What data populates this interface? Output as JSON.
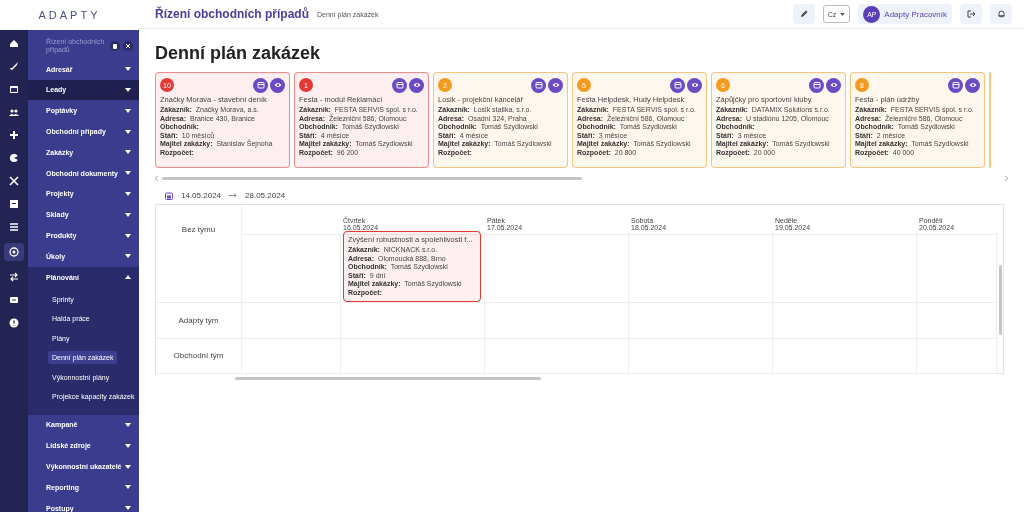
{
  "logo": "ADAPTY",
  "sidebar": {
    "title": "Řízení obchodních případů",
    "items": [
      {
        "label": "Adresář",
        "expanded": false,
        "selected": false
      },
      {
        "label": "Leady",
        "expanded": false,
        "selected": true
      },
      {
        "label": "Poptávky",
        "expanded": false,
        "selected": false
      },
      {
        "label": "Obchodní případy",
        "expanded": false,
        "selected": false
      },
      {
        "label": "Zakázky",
        "expanded": false,
        "selected": false
      },
      {
        "label": "Obchodní dokumenty",
        "expanded": false,
        "selected": false
      },
      {
        "label": "Projekty",
        "expanded": false,
        "selected": false
      },
      {
        "label": "Sklady",
        "expanded": false,
        "selected": false
      },
      {
        "label": "Produkty",
        "expanded": false,
        "selected": false
      },
      {
        "label": "Úkoly",
        "expanded": false,
        "selected": false
      },
      {
        "label": "Plánování",
        "expanded": true,
        "selected": false,
        "children": [
          {
            "label": "Sprinty",
            "selected": false
          },
          {
            "label": "Halda práce",
            "selected": false
          },
          {
            "label": "Plány",
            "selected": false
          },
          {
            "label": "Denní plán zakázek",
            "selected": true
          },
          {
            "label": "Výkonnostní plány",
            "selected": false
          },
          {
            "label": "Projekce kapacity zakázek",
            "selected": false
          }
        ]
      },
      {
        "label": "Kampaně",
        "expanded": false,
        "selected": false
      },
      {
        "label": "Lidské zdroje",
        "expanded": false,
        "selected": false
      },
      {
        "label": "Výkonnostní ukazatelé",
        "expanded": false,
        "selected": false
      },
      {
        "label": "Reporting",
        "expanded": false,
        "selected": false
      },
      {
        "label": "Postupy",
        "expanded": false,
        "selected": false
      }
    ]
  },
  "header": {
    "title": "Řízení obchodních případů",
    "breadcrumb": "Denní plán zakázek",
    "language": "Cz",
    "user_initials": "AP",
    "user_name": "Adapty Pracovník"
  },
  "page_title": "Denní plán zakázek",
  "cards": [
    {
      "badge": "10",
      "color": "#e53935",
      "title": "Značky Morava - stavební deník",
      "fields": [
        {
          "label": "Zákazník:",
          "value": "Značky Morava, a.s."
        },
        {
          "label": "Adresa:",
          "value": "Branice 430, Branice"
        },
        {
          "label": "Obchodník:"
        },
        {
          "label": "Stáří:",
          "value": "10 měsíců"
        },
        {
          "label": "Majitel zakázky:",
          "value": "Stanislav Šejnoha"
        },
        {
          "label": "Rozpočet:"
        }
      ]
    },
    {
      "badge": "1",
      "color": "#e53935",
      "title": "Festa - modul Reklamací",
      "fields": [
        {
          "label": "Zákazník:",
          "value": "FESTA SERVIS spol. s r.o."
        },
        {
          "label": "Adresa:",
          "value": "Železniční 586, Olomouc"
        },
        {
          "label": "Obchodník:",
          "value": "Tomáš Szydlowski"
        },
        {
          "label": "Stáří:",
          "value": "4 měsíce"
        },
        {
          "label": "Majitel zakázky:",
          "value": "Tomáš Szydlowski"
        },
        {
          "label": "Rozpočet:",
          "value": "96 200"
        }
      ]
    },
    {
      "badge": "2",
      "color": "#f39a1f",
      "title": "Losik - projekční kancelář",
      "fields": [
        {
          "label": "Zákazník:",
          "value": "Losik statika, s.r.o."
        },
        {
          "label": "Adresa:",
          "value": "Osadní 324, Praha"
        },
        {
          "label": "Obchodník:",
          "value": "Tomáš Szydlowski"
        },
        {
          "label": "Stáří:",
          "value": "4 měsíce"
        },
        {
          "label": "Majitel zakázky:",
          "value": "Tomáš Szydlowski"
        },
        {
          "label": "Rozpočet:"
        }
      ]
    },
    {
      "badge": "5",
      "color": "#f39a1f",
      "title": "Festa Helpdesk, Hudy Helpdesk",
      "fields": [
        {
          "label": "Zákazník:",
          "value": "FESTA SERVIS spol. s r.o."
        },
        {
          "label": "Adresa:",
          "value": "Železniční 586, Olomouc"
        },
        {
          "label": "Obchodník:",
          "value": "Tomáš Szydlowski"
        },
        {
          "label": "Stáří:",
          "value": "3 měsíce"
        },
        {
          "label": "Majitel zakázky:",
          "value": "Tomáš Szydlowski"
        },
        {
          "label": "Rozpočet:",
          "value": "20 800"
        }
      ]
    },
    {
      "badge": "6",
      "color": "#f39a1f",
      "title": "Zápůjčky pro sportovní kluby",
      "fields": [
        {
          "label": "Zákazník:",
          "value": "DATAMIX Solutions s.r.o."
        },
        {
          "label": "Adresa:",
          "value": "U stadiónu 1205, Olomouc"
        },
        {
          "label": "Obchodník:"
        },
        {
          "label": "Stáří:",
          "value": "3 měsíce"
        },
        {
          "label": "Majitel zakázky:",
          "value": "Tomáš Szydlowski"
        },
        {
          "label": "Rozpočet:",
          "value": "20 000"
        }
      ]
    },
    {
      "badge": "8",
      "color": "#f39a1f",
      "title": "Festa - plán údržby",
      "fields": [
        {
          "label": "Zákazník:",
          "value": "FESTA SERVIS spol. s r.o."
        },
        {
          "label": "Adresa:",
          "value": "Železniční 586, Olomouc"
        },
        {
          "label": "Obchodník:",
          "value": "Tomáš Szydlowski"
        },
        {
          "label": "Stáří:",
          "value": "2 měsíce"
        },
        {
          "label": "Majitel zakázky:",
          "value": "Tomáš Szydlowski"
        },
        {
          "label": "Rozpočet:",
          "value": "40 000"
        }
      ]
    }
  ],
  "date_range": {
    "from": "14.05.2024",
    "to": "28.05.2024"
  },
  "calendar": {
    "days": [
      {
        "name": "Čtvrtek",
        "date": "16.05.2024",
        "events": [
          {
            "color": "#e53935",
            "title": "Zvýšení robustnosti a spolehlivosti f...",
            "fields": [
              {
                "label": "Zákazník:",
                "value": "NICKNACK s.r.o."
              },
              {
                "label": "Adresa:",
                "value": "Olomoucká 888, Brno"
              },
              {
                "label": "Obchodník:",
                "value": "Tomáš Szydlowski"
              },
              {
                "label": "Stáří:",
                "value": "9 dní"
              },
              {
                "label": "Majitel zakázky:",
                "value": "Tomáš Szydlowski"
              },
              {
                "label": "Rozpočet:"
              }
            ]
          }
        ]
      },
      {
        "name": "Pátek",
        "date": "17.05.2024"
      },
      {
        "name": "Sobota",
        "date": "18.05.2024"
      },
      {
        "name": "Neděle",
        "date": "19.05.2024"
      },
      {
        "name": "Pondělí",
        "date": "20.05.2024"
      }
    ],
    "teams": [
      {
        "name": "Bez týmu"
      },
      {
        "name": "Adapty tým"
      },
      {
        "name": "Obchodní tým"
      }
    ]
  }
}
